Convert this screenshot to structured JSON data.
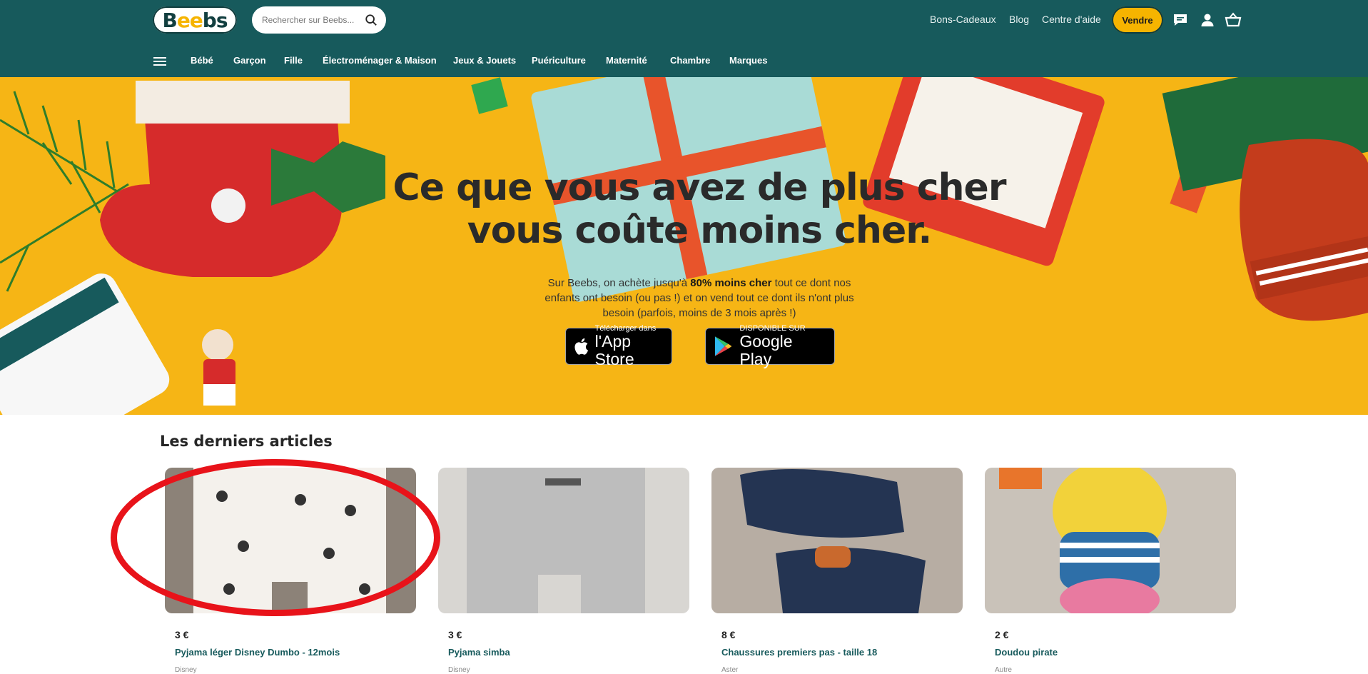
{
  "header": {
    "logo_text": "Beebs",
    "search_placeholder": "Rechercher sur Beebs...",
    "links": [
      "Bons-Cadeaux",
      "Blog",
      "Centre d'aide"
    ],
    "sell_label": "Vendre",
    "icons": [
      "chat-icon",
      "user-icon",
      "basket-icon"
    ]
  },
  "nav": {
    "categories": [
      "Bébé",
      "Garçon",
      "Fille",
      "Électroménager & Maison",
      "Jeux & Jouets",
      "Puériculture",
      "Maternité",
      "Chambre",
      "Marques"
    ]
  },
  "hero": {
    "title_line1": "Ce que vous avez de plus cher",
    "title_line2": "vous coûte moins cher.",
    "text_part1": "Sur Beebs, on achète jusqu'à ",
    "text_bold": "80% moins cher",
    "text_part2": " tout ce dont nos enfants ont besoin (ou pas !) et on vend tout ce dont ils n'ont plus besoin (parfois, moins de 3 mois après !)",
    "appstore_small": "Télécharger dans",
    "appstore_big": "l'App Store",
    "googleplay_small": "DISPONIBLE SUR",
    "googleplay_big": "Google Play"
  },
  "colors": {
    "header_bg": "#175a5c",
    "hero_bg": "#f6b515",
    "accent": "#f6b400",
    "highlight": "#e8131a"
  },
  "articles": {
    "title": "Les derniers articles",
    "items": [
      {
        "price": "3 €",
        "name": "Pyjama léger Disney Dumbo - 12mois",
        "brand": "Disney"
      },
      {
        "price": "3 €",
        "name": "Pyjama simba",
        "brand": "Disney"
      },
      {
        "price": "8 €",
        "name": "Chaussures premiers pas - taille 18",
        "brand": "Aster"
      },
      {
        "price": "2 €",
        "name": "Doudou pirate",
        "brand": "Autre"
      }
    ]
  }
}
